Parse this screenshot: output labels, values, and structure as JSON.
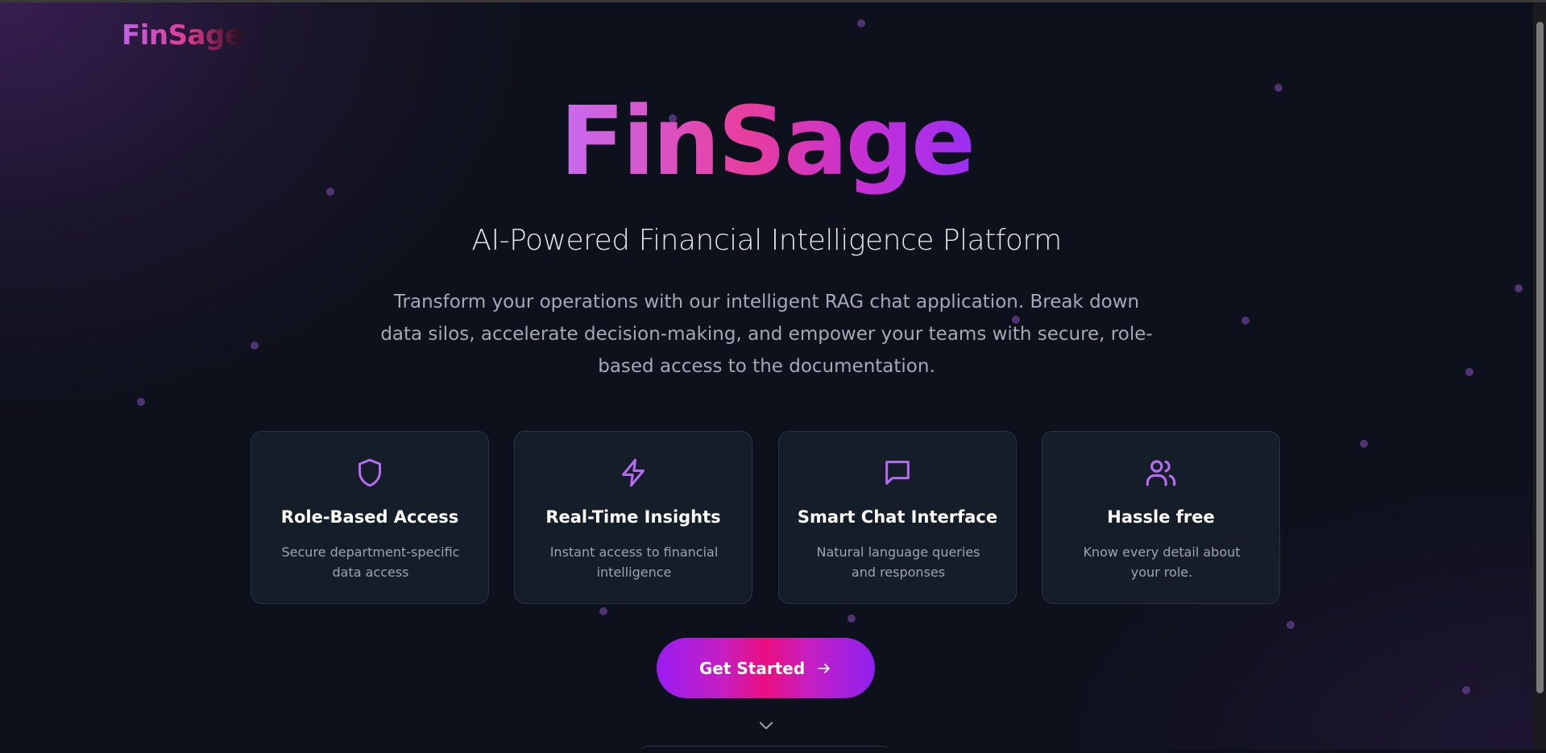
{
  "brand": {
    "logo_text": "FinSage"
  },
  "hero": {
    "title": "FinSage",
    "subtitle": "AI-Powered Financial Intelligence Platform",
    "description": "Transform your operations with our intelligent RAG chat application. Break down data silos, accelerate decision-making, and empower your teams with secure, role-based access to the documentation."
  },
  "features": [
    {
      "icon": "shield-icon",
      "title": "Role-Based Access",
      "description": "Secure department-specific data access"
    },
    {
      "icon": "lightning-icon",
      "title": "Real-Time Insights",
      "description": "Instant access to financial intelligence"
    },
    {
      "icon": "chat-bubble-icon",
      "title": "Smart Chat Interface",
      "description": "Natural language queries and responses"
    },
    {
      "icon": "users-icon",
      "title": "Hassle free",
      "description": "Know every detail about your role."
    }
  ],
  "cta": {
    "label": "Get Started",
    "icon": "arrow-right-icon"
  },
  "scroll_hint": {
    "icon": "chevron-down-icon"
  },
  "colors": {
    "background": "#0d111b",
    "accent_purple": "#b56cf0",
    "accent_pink": "#e83e9e",
    "card_bg": "#18202c",
    "muted_text": "#a6a8b6"
  }
}
